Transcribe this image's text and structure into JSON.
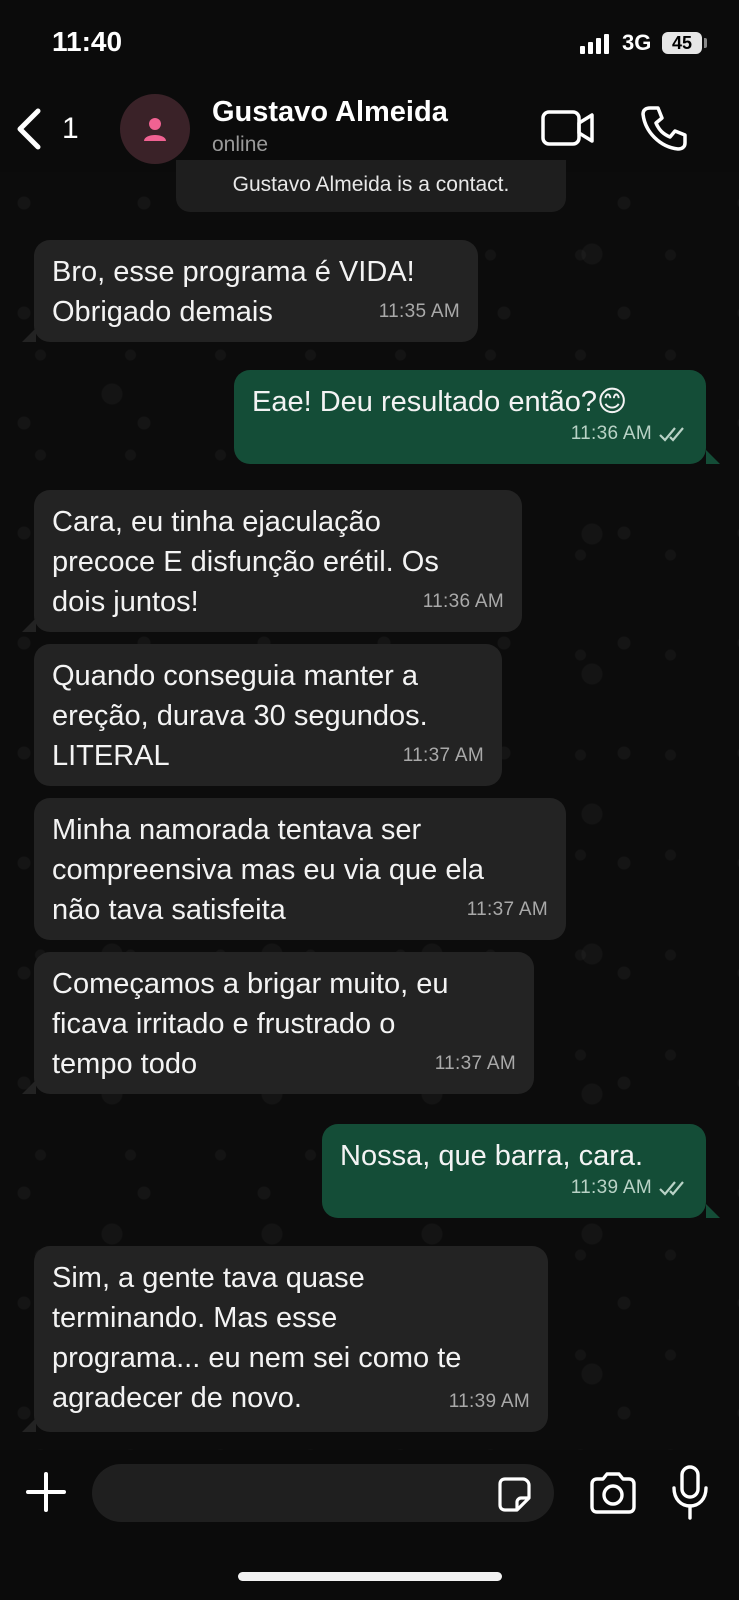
{
  "status_bar": {
    "time": "11:40",
    "network": "3G",
    "battery": "45"
  },
  "header": {
    "back_count": "1",
    "contact_name": "Gustavo Almeida",
    "contact_status": "online",
    "video_icon": "video-camera-icon",
    "call_icon": "phone-icon"
  },
  "system_note": "Gustavo Almeida is a contact.",
  "messages": [
    {
      "direction": "in",
      "text": "Bro, esse programa é VIDA!\nObrigado demais",
      "time": "11:35 AM"
    },
    {
      "direction": "out",
      "text": "Eae! Deu resultado então?😊",
      "time": "11:36 AM",
      "status": "read"
    },
    {
      "direction": "in",
      "text": "Cara, eu tinha ejaculação\nprecoce E disfunção erétil. Os\ndois juntos!",
      "time": "11:36 AM"
    },
    {
      "direction": "in",
      "text": "Quando conseguia manter a\nereção, durava 30 segundos.\nLITERAL",
      "time": "11:37 AM"
    },
    {
      "direction": "in",
      "text": "Minha namorada tentava ser\ncompreensiva mas eu via que ela\nnão tava satisfeita",
      "time": "11:37 AM"
    },
    {
      "direction": "in",
      "text": "Começamos a brigar muito, eu\nficava irritado e frustrado o\ntempo todo",
      "time": "11:37 AM"
    },
    {
      "direction": "out",
      "text": "Nossa, que barra, cara.",
      "time": "11:39 AM",
      "status": "read"
    },
    {
      "direction": "in",
      "text": "Sim, a gente tava quase\nterminando. Mas esse\nprograma... eu nem sei como te\nagradecer de novo.",
      "time": "11:39 AM"
    }
  ],
  "composer": {
    "input_value": "",
    "plus_icon": "plus-icon",
    "sticker_icon": "sticker-icon",
    "camera_icon": "camera-icon",
    "mic_icon": "microphone-icon"
  },
  "colors": {
    "incoming_bubble": "#232323",
    "outgoing_bubble": "#144d37",
    "background": "#0b0b0b"
  }
}
